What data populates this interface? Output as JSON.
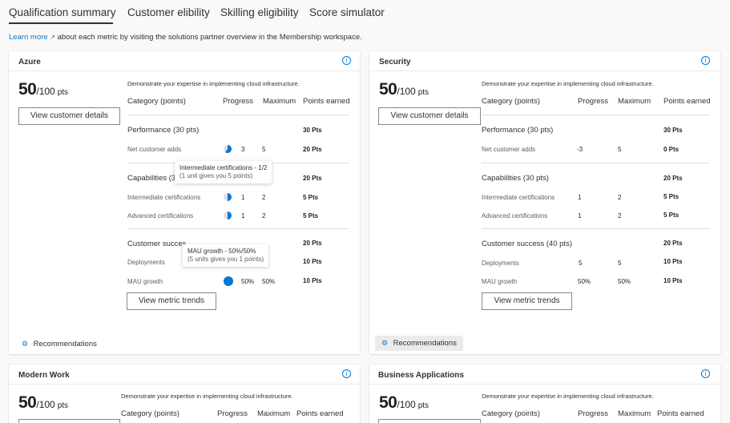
{
  "tabs": {
    "qualification": "Qualification summary",
    "customer": "Customer elibility",
    "skilling": "Skilling eligibility",
    "simulator": "Score simulator"
  },
  "info": {
    "link": "Learn more",
    "rest": "about each metric by visiting the solutions partner overview in the Membership workspace."
  },
  "common": {
    "description": "Demonstrate your expertise in implementing cloud infrastructure.",
    "col_category": "Category (points)",
    "col_progress": "Progress",
    "col_maximum": "Maximum",
    "col_earned": "Points earned",
    "score": "50",
    "score_of": "/100",
    "score_unit": "pts",
    "details_button": "View customer details",
    "trends_button": "View metric trends",
    "recommendations": "Recommendations"
  },
  "azure": {
    "title": "Azure",
    "performance": "Performance (30 pts)",
    "performance_pts": "30 Pts",
    "net_adds": "Net customer adds",
    "net_adds_progress": "3",
    "net_adds_max": "5",
    "net_adds_pts": "20 Pts",
    "capabilities": "Capabilities (3",
    "capabilities_pts": "20 Pts",
    "intermediate": "Intermediate certifications",
    "intermediate_progress": "1",
    "intermediate_max": "2",
    "intermediate_pts": "5 Pts",
    "advanced": "Advanced certifications",
    "advanced_progress": "1",
    "advanced_max": "2",
    "advanced_pts": "5 Pts",
    "success": "Customer succes",
    "success_pts": "20 Pts",
    "deployments": "Deployments",
    "deployments_pts": "10 Pts",
    "mau": "MAU growth",
    "mau_progress": "50%",
    "mau_max": "50%",
    "mau_pts": "10 Pts",
    "tooltip1_title": "Intermediate certifications - 1/2",
    "tooltip1_sub": "(1 unit gives you 5 points)",
    "tooltip2_title": "MAU growth - 50%/50%",
    "tooltip2_sub": "(5 units gives you 1 points)",
    "pie_net_adds_fraction": 0.6,
    "pie_intermediate_fraction": 0.5,
    "pie_advanced_fraction": 0.5,
    "pie_mau_fraction": 1.0
  },
  "security": {
    "title": "Security",
    "performance": "Performance (30 pts)",
    "performance_pts": "30 Pts",
    "net_adds": "Net customer adds",
    "net_adds_progress": "-3",
    "net_adds_max": "5",
    "net_adds_pts": "0 Pts",
    "capabilities": "Capabilities (30 pts)",
    "capabilities_pts": "20 Pts",
    "intermediate": "Intermediate certifications",
    "intermediate_progress": "1",
    "intermediate_max": "2",
    "intermediate_pts": "5 Pts",
    "advanced": "Advanced certifications",
    "advanced_progress": "1",
    "advanced_max": "2",
    "advanced_pts": "5 Pts",
    "success": "Customer success (40 pts)",
    "success_pts": "20 Pts",
    "deployments": "Deployments",
    "deployments_progress": "5",
    "deployments_max": "5",
    "deployments_pts": "10 Pts",
    "mau": "MAU growth",
    "mau_progress": "50%",
    "mau_max": "50%",
    "mau_pts": "10 Pts"
  },
  "modern_work": {
    "title": "Modern Work"
  },
  "business_apps": {
    "title": "Business Applications"
  },
  "colors": {
    "accent": "#0078d4",
    "pie_empty": "#e1dfdd"
  }
}
